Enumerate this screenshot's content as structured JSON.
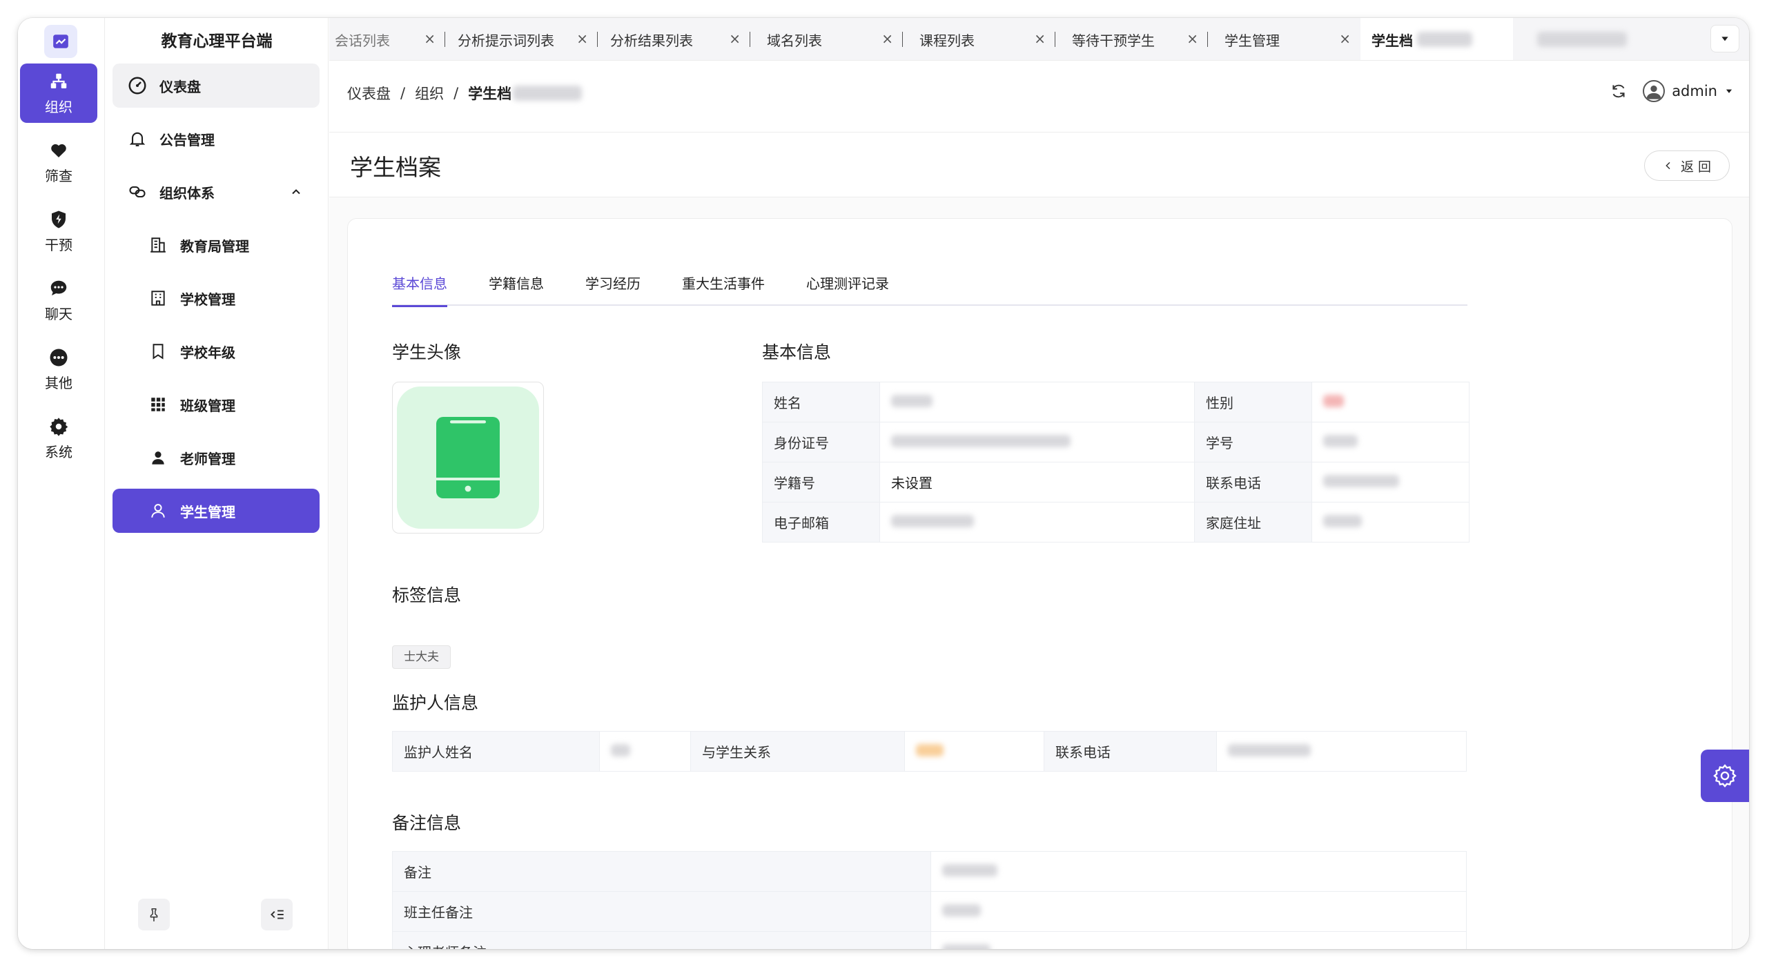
{
  "app": {
    "title": "教育心理平台端"
  },
  "rail": {
    "items": [
      {
        "label": "组织",
        "icon": "org-icon",
        "active": true
      },
      {
        "label": "筛查",
        "icon": "heart-icon"
      },
      {
        "label": "干预",
        "icon": "shield-icon"
      },
      {
        "label": "聊天",
        "icon": "chat-icon"
      },
      {
        "label": "其他",
        "icon": "more-icon"
      },
      {
        "label": "系统",
        "icon": "gear-icon"
      }
    ]
  },
  "sidebar": {
    "items": [
      {
        "label": "仪表盘",
        "icon": "dashboard-icon"
      },
      {
        "label": "公告管理",
        "icon": "bell-icon"
      },
      {
        "label": "组织体系",
        "icon": "link-icon"
      },
      {
        "label": "教育局管理",
        "icon": "building-icon"
      },
      {
        "label": "学校管理",
        "icon": "school-icon"
      },
      {
        "label": "学校年级",
        "icon": "bookmark-icon"
      },
      {
        "label": "班级管理",
        "icon": "grid-icon"
      },
      {
        "label": "老师管理",
        "icon": "user-icon"
      },
      {
        "label": "学生管理",
        "icon": "user-outline-icon"
      }
    ]
  },
  "tabs": [
    {
      "label": "会话列表"
    },
    {
      "label": "分析提示词列表"
    },
    {
      "label": "分析结果列表"
    },
    {
      "label": "域名列表"
    },
    {
      "label": "课程列表"
    },
    {
      "label": "等待干预学生"
    },
    {
      "label": "学生管理"
    },
    {
      "label": "学生档"
    }
  ],
  "header": {
    "breadcrumb": [
      "仪表盘",
      "组织",
      "学生档"
    ],
    "user": "admin"
  },
  "page": {
    "title": "学生档案",
    "back_label": "返 回"
  },
  "inner_tabs": [
    "基本信息",
    "学籍信息",
    "学习经历",
    "重大生活事件",
    "心理测评记录"
  ],
  "sections": {
    "avatar": "学生头像",
    "basic": "基本信息",
    "tags": "标签信息",
    "guardian": "监护人信息",
    "notes": "备注信息"
  },
  "basic_info": {
    "name_label": "姓名",
    "gender_label": "性别",
    "id_card_label": "身份证号",
    "student_no_label": "学号",
    "school_no_label": "学籍号",
    "school_no_value": "未设置",
    "phone_label": "联系电话",
    "email_label": "电子邮箱",
    "address_label": "家庭住址"
  },
  "tags": [
    "士大夫"
  ],
  "guardian": {
    "name_label": "监护人姓名",
    "relation_label": "与学生关系",
    "phone_label": "联系电话"
  },
  "notes": {
    "remark_label": "备注",
    "teacher_label": "班主任备注",
    "psych_label": "心理老师备注"
  },
  "colors": {
    "accent": "#5b49d6",
    "avatar_bg": "#dcf7e3",
    "avatar_icon": "#2fc468"
  }
}
